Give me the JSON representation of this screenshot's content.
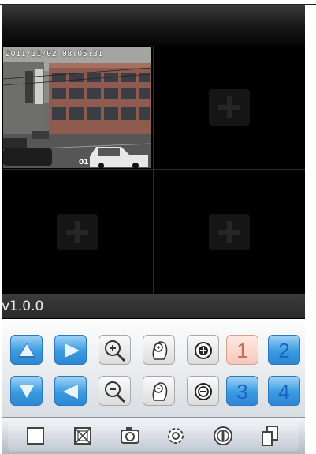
{
  "camera_feed": {
    "timestamp": "2011/11/02 08:05:31",
    "channel": "01"
  },
  "version": "v1.0.0",
  "empty_slots": [
    "add-channel-2",
    "add-channel-3",
    "add-channel-4"
  ],
  "controls": {
    "row1": [
      {
        "name": "ptz-up-button",
        "icon": "arrow-up-icon"
      },
      {
        "name": "ptz-right-button",
        "icon": "arrow-right-icon"
      },
      {
        "name": "zoom-in-button",
        "icon": "zoom-in-icon"
      },
      {
        "name": "focus-near-button",
        "icon": "focus-in-icon"
      },
      {
        "name": "iris-open-button",
        "icon": "plus-circle-icon"
      }
    ],
    "row2": [
      {
        "name": "ptz-down-button",
        "icon": "arrow-down-icon"
      },
      {
        "name": "ptz-left-button",
        "icon": "arrow-left-icon"
      },
      {
        "name": "zoom-out-button",
        "icon": "zoom-out-icon"
      },
      {
        "name": "focus-far-button",
        "icon": "focus-out-icon"
      },
      {
        "name": "iris-close-button",
        "icon": "minus-circle-icon"
      }
    ],
    "channels": [
      "1",
      "2",
      "3",
      "4"
    ],
    "selected_channel": "1"
  },
  "toolbar": [
    "single-view-icon",
    "quad-view-icon",
    "snapshot-icon",
    "settings-icon",
    "info-icon",
    "multi-page-icon"
  ],
  "colors": {
    "accent_blue": "#3a9ae0",
    "selected_pink": "#f5c9bc",
    "channel_text": "#1b63c6"
  }
}
